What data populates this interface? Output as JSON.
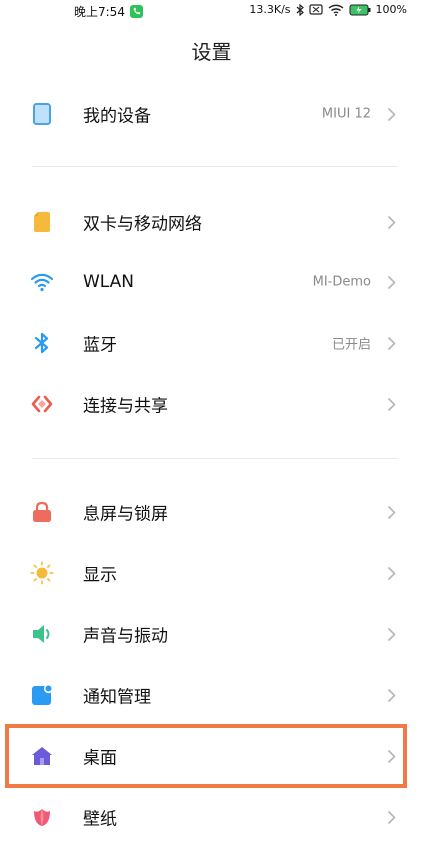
{
  "status_bar": {
    "time": "晚上7:54",
    "net_speed": "13.3K/s",
    "battery": "100%"
  },
  "header": {
    "title": "设置"
  },
  "settings": {
    "device": {
      "label": "我的设备",
      "value": "MIUI 12"
    },
    "sim": {
      "label": "双卡与移动网络",
      "value": ""
    },
    "wlan": {
      "label": "WLAN",
      "value": "MI-Demo"
    },
    "bluetooth": {
      "label": "蓝牙",
      "value": "已开启"
    },
    "connection": {
      "label": "连接与共享",
      "value": ""
    },
    "lockscreen": {
      "label": "息屏与锁屏",
      "value": ""
    },
    "display": {
      "label": "显示",
      "value": ""
    },
    "sound": {
      "label": "声音与振动",
      "value": ""
    },
    "notifications": {
      "label": "通知管理",
      "value": ""
    },
    "desktop": {
      "label": "桌面",
      "value": ""
    },
    "wallpaper": {
      "label": "壁纸",
      "value": ""
    }
  },
  "colors": {
    "highlight": "#f07a45",
    "device_icon": "#4aa3e8",
    "sim_icon": "#f5b93b",
    "wlan_icon": "#2b9af3",
    "bluetooth_icon": "#2b9af3",
    "connection_icon": "#ef5a4c",
    "lockscreen_icon": "#ef6b5e",
    "display_icon": "#f5b93b",
    "sound_icon": "#3cc38a",
    "notifications_icon": "#2b9af3",
    "desktop_icon": "#6a5cd8",
    "wallpaper_icon": "#ef5a74"
  }
}
